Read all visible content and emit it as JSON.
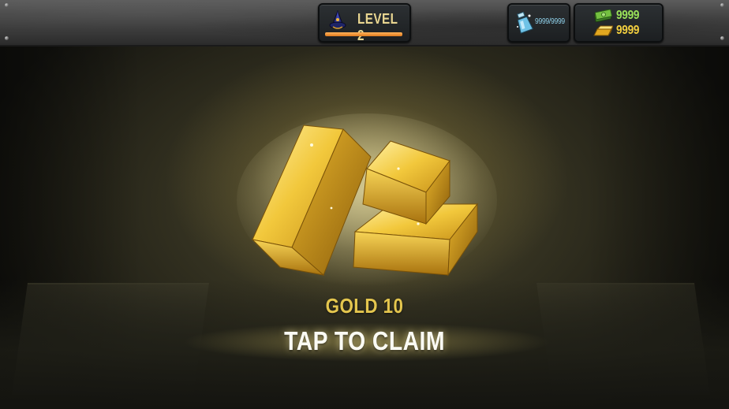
{
  "hud": {
    "level_label": "LEVEL 2",
    "level_progress_fraction": 1.0,
    "level_icon": "mage-hat-icon",
    "gems_value": "9999/9999",
    "gems_icon": "potion-bottle-icon",
    "cash_value": "9999",
    "cash_icon": "cash-stack-icon",
    "gold_value": "9999",
    "gold_icon": "gold-bar-icon"
  },
  "reward": {
    "item_icon": "gold-bars-icon",
    "title": "GOLD 10",
    "action": "TAP TO CLAIM"
  },
  "colors": {
    "level_text": "#e8d590",
    "level_bar": "#f0923a",
    "gems_text": "#8fd0ea",
    "cash_text": "#9be35a",
    "gold_text": "#f3cf3f",
    "reward_title": "#e4c64e",
    "claim_text": "#fbfbf4"
  }
}
